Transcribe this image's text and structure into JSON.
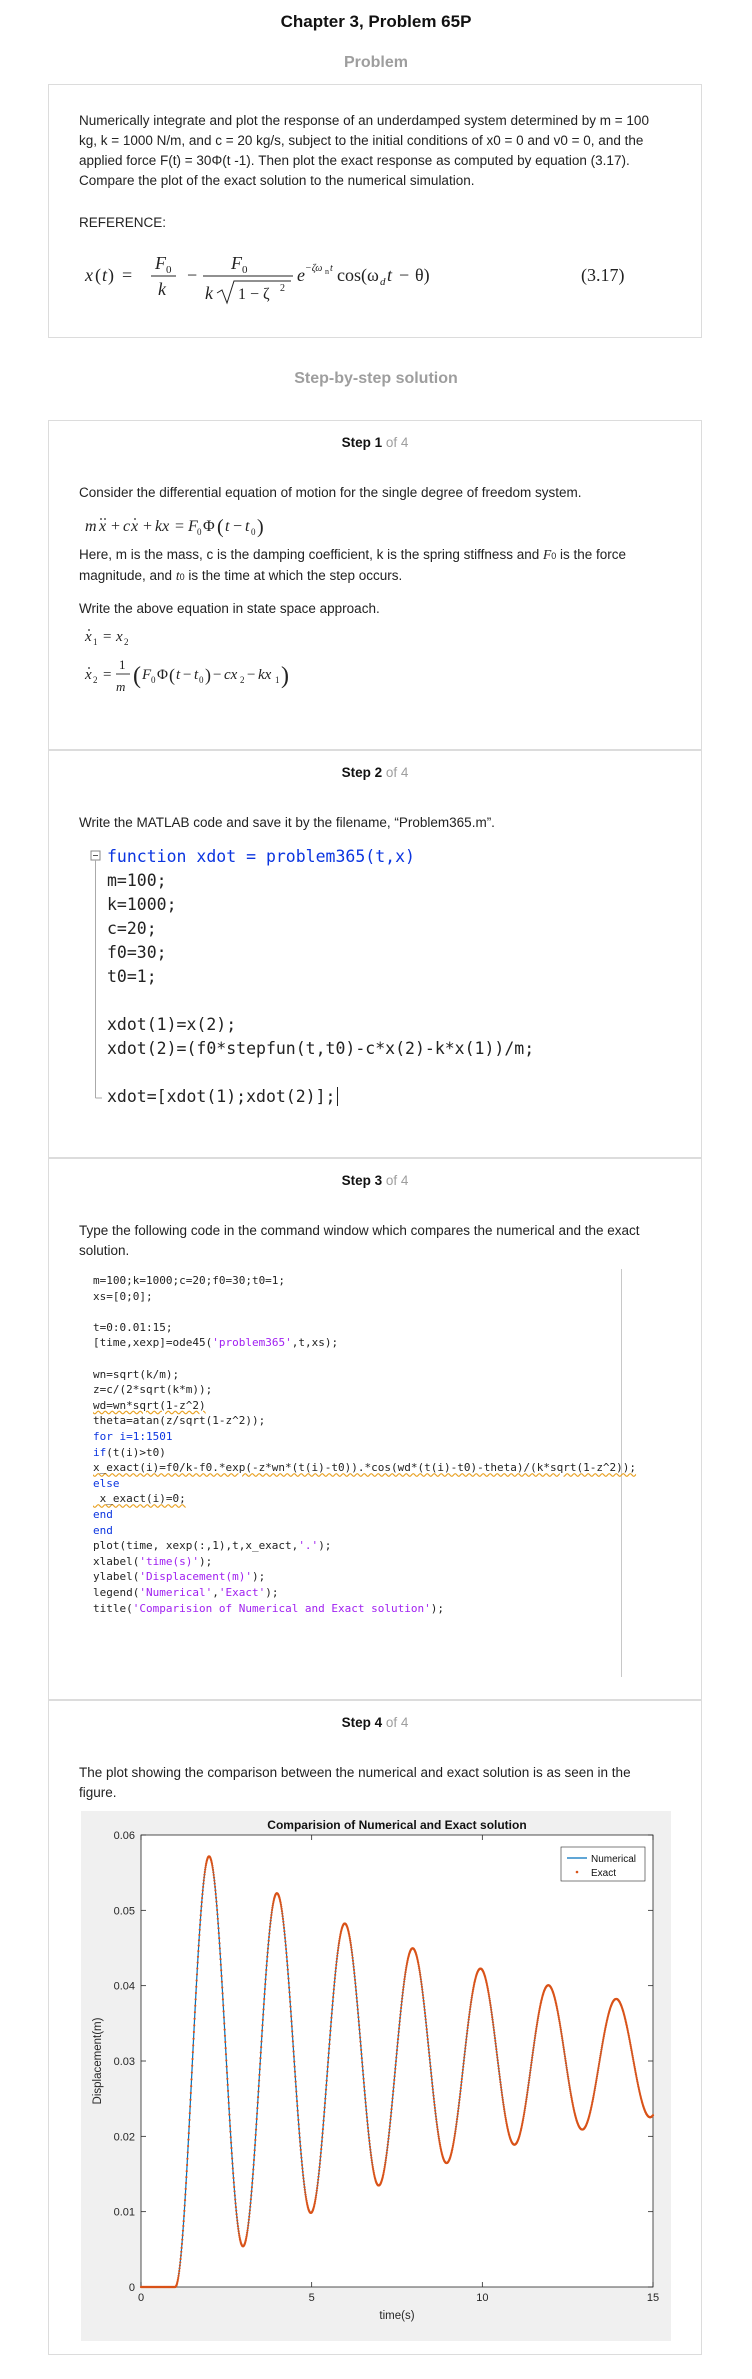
{
  "page": {
    "title": "Chapter 3, Problem 65P",
    "problem_heading": "Problem",
    "solution_heading": "Step-by-step solution"
  },
  "problem": {
    "para_1": "Numerically integrate and plot the response of an underdamped system determined by m = 100 kg, k = 1000 N/m, and c = 20 kg/s, subject to the initial conditions of x0 = 0 and v0 = 0, and the applied force F(t) = 30Φ(t -1). Then plot the exact response as computed by equation (3.17). Compare the plot of the exact solution to the numerical simulation.",
    "reference": "REFERENCE:",
    "equation_number": "(3.17)"
  },
  "steps": [
    {
      "label": "Step 1",
      "of": "of 4",
      "text_1": "Consider the differential equation of motion for the single degree of freedom system.",
      "text_2a": "Here, m is the mass, c is the damping coefficient, k is the spring stiffness and",
      "text_2b": "is the force magnitude, and",
      "text_2c": "is the time at which the step occurs.",
      "text_3": "Write the above equation in state space approach."
    },
    {
      "label": "Step 2",
      "of": "of 4",
      "text_1": "Write the MATLAB code and save it by the filename, “Problem365.m”."
    },
    {
      "label": "Step 3",
      "of": "of 4",
      "text_1": "Type the following code in the command window which compares the numerical and the exact solution."
    },
    {
      "label": "Step 4",
      "of": "of 4",
      "text_1": "The plot showing the comparison between the numerical and exact solution is as seen in the figure."
    }
  ],
  "code_function": [
    "function xdot = problem365(t,x)",
    "m=100;",
    "k=1000;",
    "c=20;",
    "f0=30;",
    "t0=1;",
    "",
    "xdot(1)=x(2);",
    "xdot(2)=(f0*stepfun(t,t0)-c*x(2)-k*x(1))/m;",
    "",
    "xdot=[xdot(1);xdot(2)];"
  ],
  "code_command": [
    "m=100;k=1000;c=20;f0=30;t0=1;",
    "xs=[0;0];",
    "",
    "t=0:0.01:15;",
    "[time,xexp]=ode45('problem365',t,xs);",
    "",
    "wn=sqrt(k/m);",
    "z=c/(2*sqrt(k*m));",
    "wd=wn*sqrt(1-z^2)",
    "theta=atan(z/sqrt(1-z^2));",
    "for i=1:1501",
    "if(t(i)>t0)",
    "x_exact(i)=f0/k-f0.*exp(-z*wn*(t(i)-t0)).*cos(wd*(t(i)-t0)-theta)/(k*sqrt(1-z^2));",
    "else",
    " x_exact(i)=0;",
    "end",
    "end",
    "plot(time, xexp(:,1),t,x_exact,'.');",
    "xlabel('time(s)');",
    "ylabel('Displacement(m)');",
    "legend('Numerical','Exact');",
    "title('Comparision of Numerical and Exact solution');"
  ],
  "chart_data": {
    "type": "line",
    "title": "Comparision of Numerical and Exact solution",
    "xlabel": "time(s)",
    "ylabel": "Displacement(m)",
    "xlim": [
      0,
      15
    ],
    "ylim": [
      0,
      0.06
    ],
    "xticks": [
      "0",
      "5",
      "10",
      "15"
    ],
    "yticks": [
      "0",
      "0.01",
      "0.02",
      "0.03",
      "0.04",
      "0.05",
      "0.06"
    ],
    "legend_position": "top-right",
    "model": {
      "m": 100,
      "k": 1000,
      "c": 20,
      "f0": 30,
      "t0": 1,
      "dt": 0.01,
      "t_end": 15
    },
    "series": [
      {
        "name": "Numerical",
        "style": "solid line",
        "color": "#0072bd"
      },
      {
        "name": "Exact",
        "style": "dots",
        "color": "#d95319"
      }
    ]
  }
}
